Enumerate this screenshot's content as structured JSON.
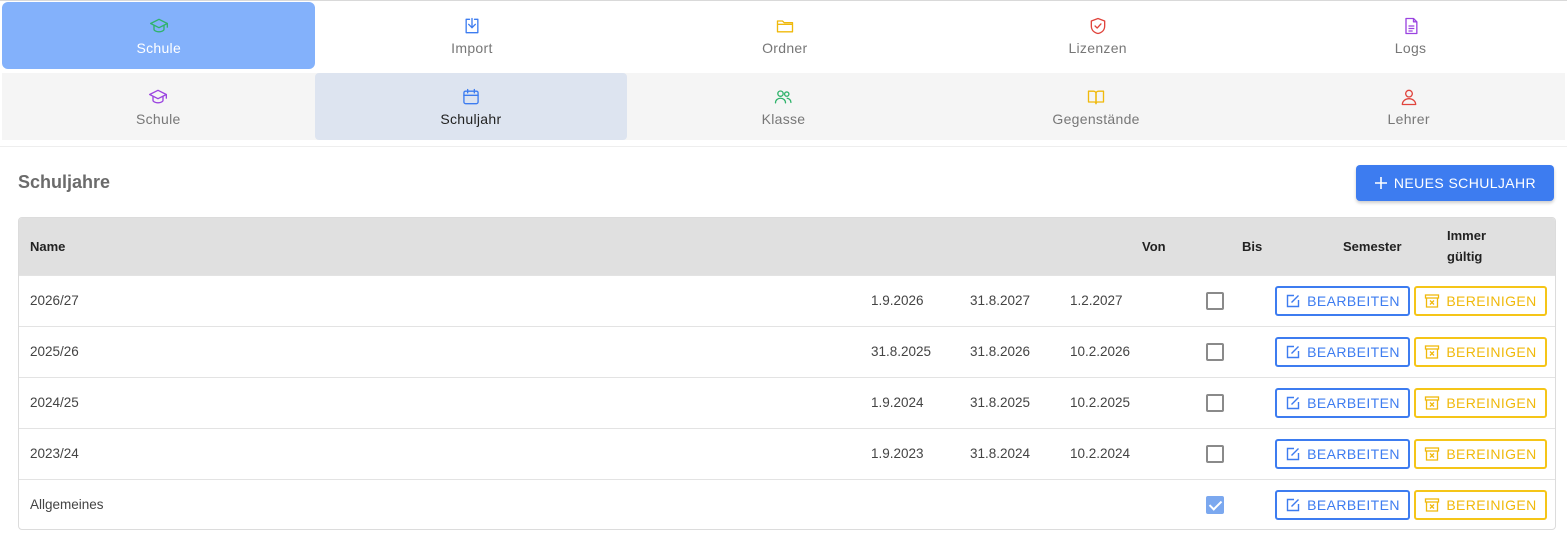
{
  "topnav": {
    "items": [
      {
        "label": "Schule",
        "icon": "graduation-cap-icon",
        "color": "#2fb36b"
      },
      {
        "label": "Import",
        "icon": "import-icon",
        "color": "#3d7cf0"
      },
      {
        "label": "Ordner",
        "icon": "folder-icon",
        "color": "#f0b90b"
      },
      {
        "label": "Lizenzen",
        "icon": "shield-check-icon",
        "color": "#e0443c"
      },
      {
        "label": "Logs",
        "icon": "document-icon",
        "color": "#9b44e0"
      }
    ]
  },
  "subnav": {
    "items": [
      {
        "label": "Schule",
        "icon": "graduation-cap-icon",
        "color": "#9b44e0"
      },
      {
        "label": "Schuljahr",
        "icon": "calendar-icon",
        "color": "#3d7cf0"
      },
      {
        "label": "Klasse",
        "icon": "users-icon",
        "color": "#2fb36b"
      },
      {
        "label": "Gegenstände",
        "icon": "book-icon",
        "color": "#f0b90b"
      },
      {
        "label": "Lehrer",
        "icon": "user-icon",
        "color": "#e0443c"
      }
    ]
  },
  "page": {
    "title": "Schuljahre",
    "new_button": "NEUES SCHULJAHR"
  },
  "table": {
    "headers": {
      "name": "Name",
      "von": "Von",
      "bis": "Bis",
      "semester": "Semester",
      "immer_line1": "Immer",
      "immer_line2": "gültig"
    },
    "edit_label": "BEARBEITEN",
    "clean_label": "BEREINIGEN",
    "rows": [
      {
        "name": "2026/27",
        "von": "1.9.2026",
        "bis": "31.8.2027",
        "semester": "1.2.2027",
        "immer_gueltig": false
      },
      {
        "name": "2025/26",
        "von": "31.8.2025",
        "bis": "31.8.2026",
        "semester": "10.2.2026",
        "immer_gueltig": false
      },
      {
        "name": "2024/25",
        "von": "1.9.2024",
        "bis": "31.8.2025",
        "semester": "10.2.2025",
        "immer_gueltig": false
      },
      {
        "name": "2023/24",
        "von": "1.9.2023",
        "bis": "31.8.2024",
        "semester": "10.2.2024",
        "immer_gueltig": false
      },
      {
        "name": "Allgemeines",
        "von": "",
        "bis": "",
        "semester": "",
        "immer_gueltig": true
      }
    ]
  },
  "colors": {
    "primary": "#3d7cf0",
    "active_tab": "#83b1fb",
    "warning": "#f0b90b"
  }
}
